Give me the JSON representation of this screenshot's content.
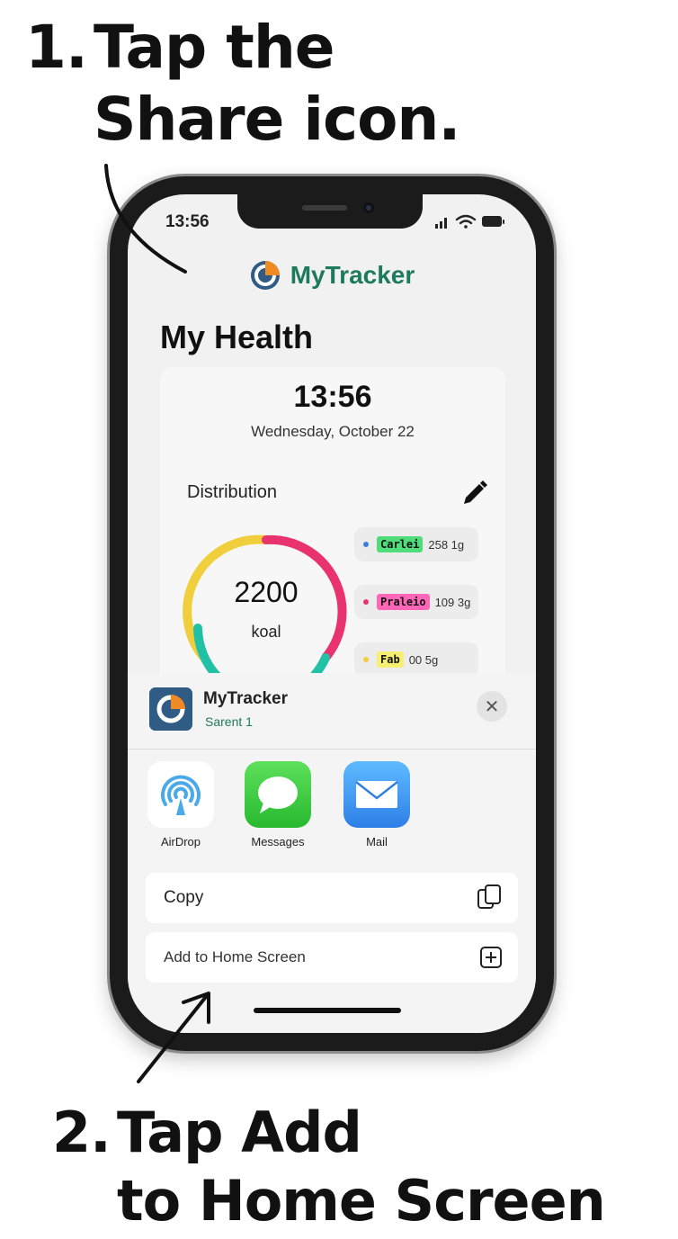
{
  "instructions": {
    "step1_number": "1.",
    "step1_line1": "Tap the",
    "step1_line2": "Share icon.",
    "step2_number": "2.",
    "step2_line1": "Tap Add",
    "step2_line2": "to Home Screen"
  },
  "status_bar": {
    "time": "13:56"
  },
  "app": {
    "name": "MyTracker",
    "brand_color": "#1e7a5c"
  },
  "page": {
    "title": "My Health"
  },
  "summary": {
    "clock": "13:56",
    "date": "Wednesday, October 22",
    "distribution_label": "Distribution",
    "kcal_value": "2200",
    "kcal_unit": "koal",
    "macros": [
      {
        "name": "Carlei",
        "amount": "258 1g",
        "dot_color": "#3d7fd6",
        "tag_color": "#4fdc7a"
      },
      {
        "name": "Praleio",
        "amount": "109 3g",
        "dot_color": "#e8336e",
        "tag_color": "#ff66b8"
      },
      {
        "name": "Fab",
        "amount": "00 5g",
        "dot_color": "#f1cf3c",
        "tag_color": "#f7ef72"
      }
    ]
  },
  "share_sheet": {
    "app_name": "MyTracker",
    "subtitle": "Sarent 1",
    "apps": [
      {
        "label": "AirDrop",
        "icon": "airdrop-icon"
      },
      {
        "label": "Messages",
        "icon": "messages-icon"
      },
      {
        "label": "Mail",
        "icon": "mail-icon"
      }
    ],
    "actions": [
      {
        "label": "Copy",
        "icon": "copy-icon"
      },
      {
        "label": "Add to Home Screen",
        "icon": "add-square-icon"
      }
    ]
  }
}
